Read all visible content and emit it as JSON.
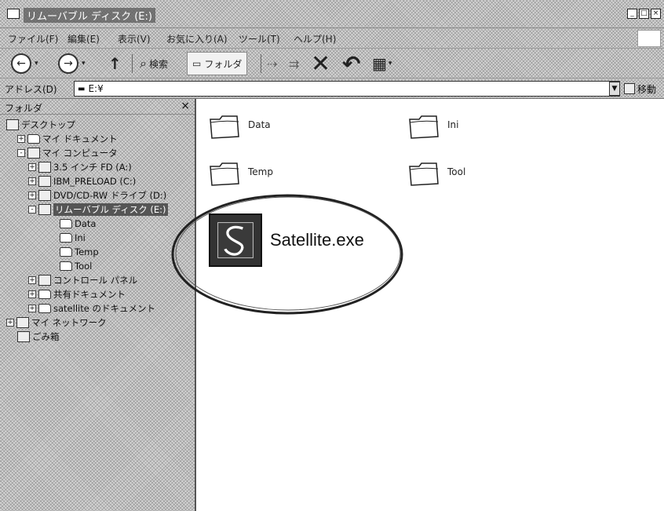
{
  "window": {
    "title": "リムーバブル ディスク (E:)",
    "controls": {
      "minimize": "_",
      "restore": "□",
      "close": "×"
    }
  },
  "menubar": {
    "items": [
      {
        "label": "ファイル(F)"
      },
      {
        "label": "編集(E)"
      },
      {
        "label": "表示(V)"
      },
      {
        "label": "お気に入り(A)"
      },
      {
        "label": "ツール(T)"
      },
      {
        "label": "ヘルプ(H)"
      }
    ]
  },
  "toolbar": {
    "back_label": "←",
    "forward_label": "→",
    "up_label": "↑",
    "search_label": "検索",
    "folders_label": "フォルダ",
    "delete_glyph": "✕",
    "undo_glyph": "↶",
    "views_glyph": "▦"
  },
  "addressbar": {
    "label": "アドレス(D)",
    "value": "E:¥",
    "go_label": "移動"
  },
  "folder_pane": {
    "header": "フォルダ",
    "close_glyph": "×",
    "tree": [
      {
        "label": "デスクトップ",
        "icon": "desktop-icon",
        "expander": ""
      },
      {
        "label": "マイ ドキュメント",
        "icon": "folder-icon",
        "expander": "+"
      },
      {
        "label": "マイ コンピュータ",
        "icon": "computer-icon",
        "expander": "-"
      },
      {
        "label": "3.5 インチ FD (A:)",
        "icon": "floppy-icon",
        "expander": "+"
      },
      {
        "label": "IBM_PRELOAD (C:)",
        "icon": "drive-icon",
        "expander": "+"
      },
      {
        "label": "DVD/CD-RW ドライブ (D:)",
        "icon": "cd-drive-icon",
        "expander": "+"
      },
      {
        "label": "リムーバブル ディスク (E:)",
        "icon": "removable-disk-icon",
        "expander": "-"
      },
      {
        "label": "Data",
        "icon": "folder-icon",
        "expander": ""
      },
      {
        "label": "Ini",
        "icon": "folder-icon",
        "expander": ""
      },
      {
        "label": "Temp",
        "icon": "folder-icon",
        "expander": ""
      },
      {
        "label": "Tool",
        "icon": "folder-icon",
        "expander": ""
      },
      {
        "label": "コントロール パネル",
        "icon": "control-panel-icon",
        "expander": "+"
      },
      {
        "label": "共有ドキュメント",
        "icon": "folder-icon",
        "expander": "+"
      },
      {
        "label": "satellite のドキュメント",
        "icon": "folder-icon",
        "expander": "+"
      },
      {
        "label": "マイ ネットワーク",
        "icon": "network-icon",
        "expander": "+"
      },
      {
        "label": "ごみ箱",
        "icon": "recycle-bin-icon",
        "expander": ""
      }
    ]
  },
  "content": {
    "items": [
      {
        "label": "Data",
        "icon": "folder-icon"
      },
      {
        "label": "Ini",
        "icon": "folder-icon"
      },
      {
        "label": "Temp",
        "icon": "folder-icon"
      },
      {
        "label": "Tool",
        "icon": "folder-icon"
      },
      {
        "label": "Satellite.exe",
        "icon": "satellite-app-icon"
      }
    ]
  },
  "colors": {
    "selection": "#555555",
    "background": "#ffffff",
    "chrome": "#d4d4d4"
  }
}
